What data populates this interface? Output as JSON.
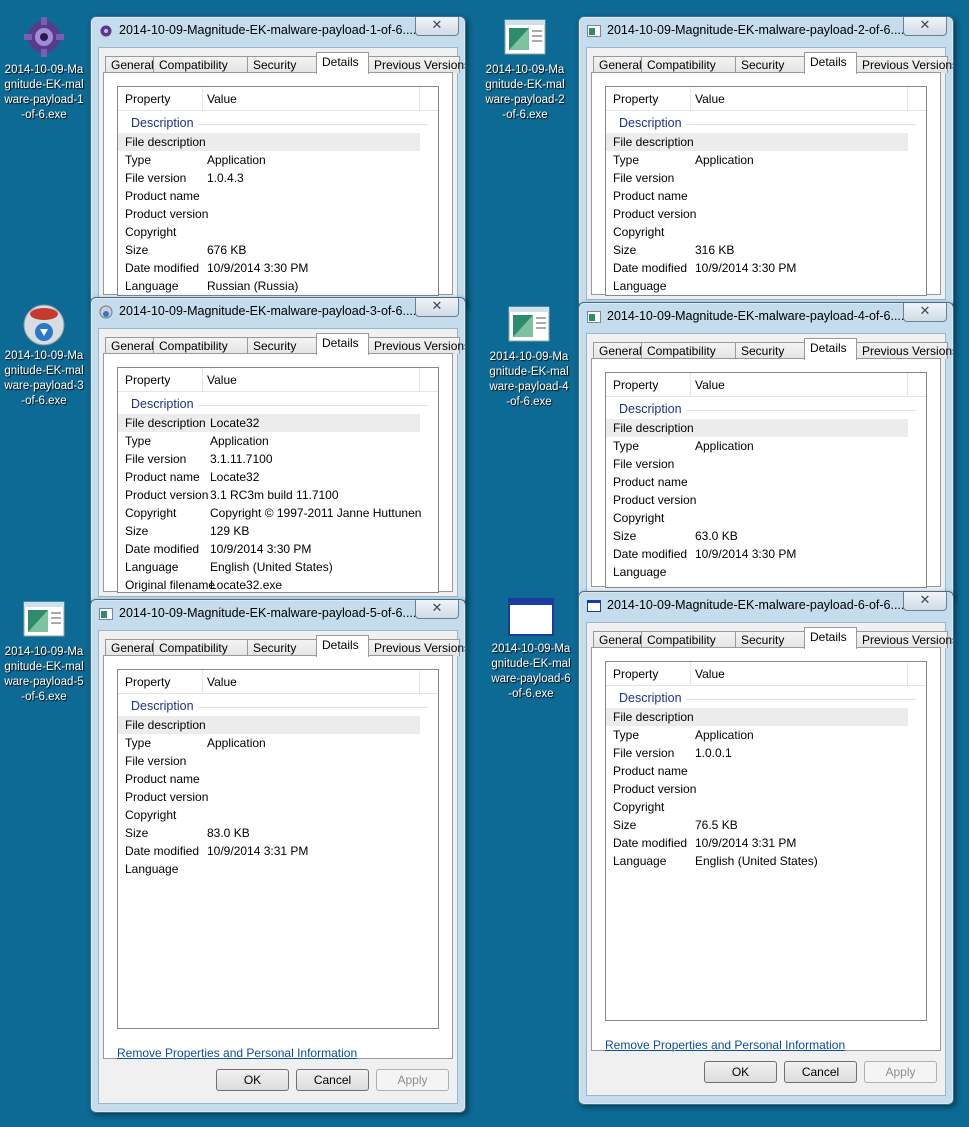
{
  "desktop_icons": [
    {
      "id": "icon1",
      "label": "2014-10-09-Magnitude-EK-malware-payload-1-of-6.exe",
      "icon": "purple-gear-icon"
    },
    {
      "id": "icon2",
      "label": "2014-10-09-Magnitude-EK-malware-payload-2-of-6.exe",
      "icon": "generic-exe-icon"
    },
    {
      "id": "icon3",
      "label": "2014-10-09-Magnitude-EK-malware-payload-3-of-6.exe",
      "icon": "nsis-installer-icon"
    },
    {
      "id": "icon4",
      "label": "2014-10-09-Magnitude-EK-malware-payload-4-of-6.exe",
      "icon": "generic-exe-icon"
    },
    {
      "id": "icon5",
      "label": "2014-10-09-Magnitude-EK-malware-payload-5-of-6.exe",
      "icon": "generic-exe-icon"
    },
    {
      "id": "icon6",
      "label": "2014-10-09-Magnitude-EK-malware-payload-6-of-6.exe",
      "icon": "window-app-icon"
    }
  ],
  "tabs": [
    "General",
    "Compatibility",
    "Security",
    "Details",
    "Previous Versions"
  ],
  "columns": {
    "property": "Property",
    "value": "Value"
  },
  "section_label": "Description",
  "remove_link": "Remove Properties and Personal Information",
  "buttons": {
    "ok": "OK",
    "cancel": "Cancel",
    "apply": "Apply"
  },
  "close_glyph": "✕",
  "windows": [
    {
      "title": "2014-10-09-Magnitude-EK-malware-payload-1-of-6....",
      "rows": [
        [
          "File description",
          ""
        ],
        [
          "Type",
          "Application"
        ],
        [
          "File version",
          "1.0.4.3"
        ],
        [
          "Product name",
          ""
        ],
        [
          "Product version",
          ""
        ],
        [
          "Copyright",
          ""
        ],
        [
          "Size",
          "676 KB"
        ],
        [
          "Date modified",
          "10/9/2014 3:30 PM"
        ],
        [
          "Language",
          "Russian (Russia)"
        ]
      ]
    },
    {
      "title": "2014-10-09-Magnitude-EK-malware-payload-2-of-6....",
      "rows": [
        [
          "File description",
          ""
        ],
        [
          "Type",
          "Application"
        ],
        [
          "File version",
          ""
        ],
        [
          "Product name",
          ""
        ],
        [
          "Product version",
          ""
        ],
        [
          "Copyright",
          ""
        ],
        [
          "Size",
          "316 KB"
        ],
        [
          "Date modified",
          "10/9/2014 3:30 PM"
        ],
        [
          "Language",
          ""
        ]
      ]
    },
    {
      "title": "2014-10-09-Magnitude-EK-malware-payload-3-of-6....",
      "rows": [
        [
          "File description",
          "Locate32"
        ],
        [
          "Type",
          "Application"
        ],
        [
          "File version",
          "3.1.11.7100"
        ],
        [
          "Product name",
          "Locate32"
        ],
        [
          "Product version",
          "3.1 RC3m build 11.7100"
        ],
        [
          "Copyright",
          "Copyright © 1997-2011 Janne Huttunen"
        ],
        [
          "Size",
          "129 KB"
        ],
        [
          "Date modified",
          "10/9/2014 3:30 PM"
        ],
        [
          "Language",
          "English (United States)"
        ],
        [
          "Original filename",
          "Locate32.exe"
        ]
      ]
    },
    {
      "title": "2014-10-09-Magnitude-EK-malware-payload-4-of-6....",
      "rows": [
        [
          "File description",
          ""
        ],
        [
          "Type",
          "Application"
        ],
        [
          "File version",
          ""
        ],
        [
          "Product name",
          ""
        ],
        [
          "Product version",
          ""
        ],
        [
          "Copyright",
          ""
        ],
        [
          "Size",
          "63.0 KB"
        ],
        [
          "Date modified",
          "10/9/2014 3:30 PM"
        ],
        [
          "Language",
          ""
        ]
      ]
    },
    {
      "title": "2014-10-09-Magnitude-EK-malware-payload-5-of-6....",
      "rows": [
        [
          "File description",
          ""
        ],
        [
          "Type",
          "Application"
        ],
        [
          "File version",
          ""
        ],
        [
          "Product name",
          ""
        ],
        [
          "Product version",
          ""
        ],
        [
          "Copyright",
          ""
        ],
        [
          "Size",
          "83.0 KB"
        ],
        [
          "Date modified",
          "10/9/2014 3:31 PM"
        ],
        [
          "Language",
          ""
        ]
      ]
    },
    {
      "title": "2014-10-09-Magnitude-EK-malware-payload-6-of-6....",
      "rows": [
        [
          "File description",
          ""
        ],
        [
          "Type",
          "Application"
        ],
        [
          "File version",
          "1.0.0.1"
        ],
        [
          "Product name",
          ""
        ],
        [
          "Product version",
          ""
        ],
        [
          "Copyright",
          ""
        ],
        [
          "Size",
          "76.5 KB"
        ],
        [
          "Date modified",
          "10/9/2014 3:31 PM"
        ],
        [
          "Language",
          "English (United States)"
        ]
      ]
    }
  ]
}
